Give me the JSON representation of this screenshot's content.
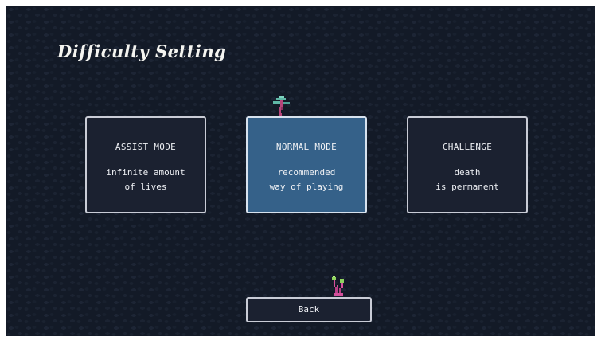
{
  "screen": {
    "title": "Difficulty Setting"
  },
  "modes": [
    {
      "label": "ASSIST MODE",
      "desc_line1": "infinite amount",
      "desc_line2": "of lives",
      "selected": false
    },
    {
      "label": "NORMAL MODE",
      "desc_line1": "recommended",
      "desc_line2": "way of playing",
      "selected": true
    },
    {
      "label": "CHALLENGE",
      "desc_line1": "death",
      "desc_line2": "is permanent",
      "selected": false
    }
  ],
  "back_button": {
    "label": "Back"
  },
  "decorations": {
    "top_plant_icon": "teal-tree-sprite-icon",
    "bottom_plant_icon": "pink-sprout-sprite-icon"
  },
  "colors": {
    "background": "#131a27",
    "card": "#1b2130",
    "selected_card": "#356189",
    "border": "#c9ccd6",
    "text": "#eef0f4"
  }
}
